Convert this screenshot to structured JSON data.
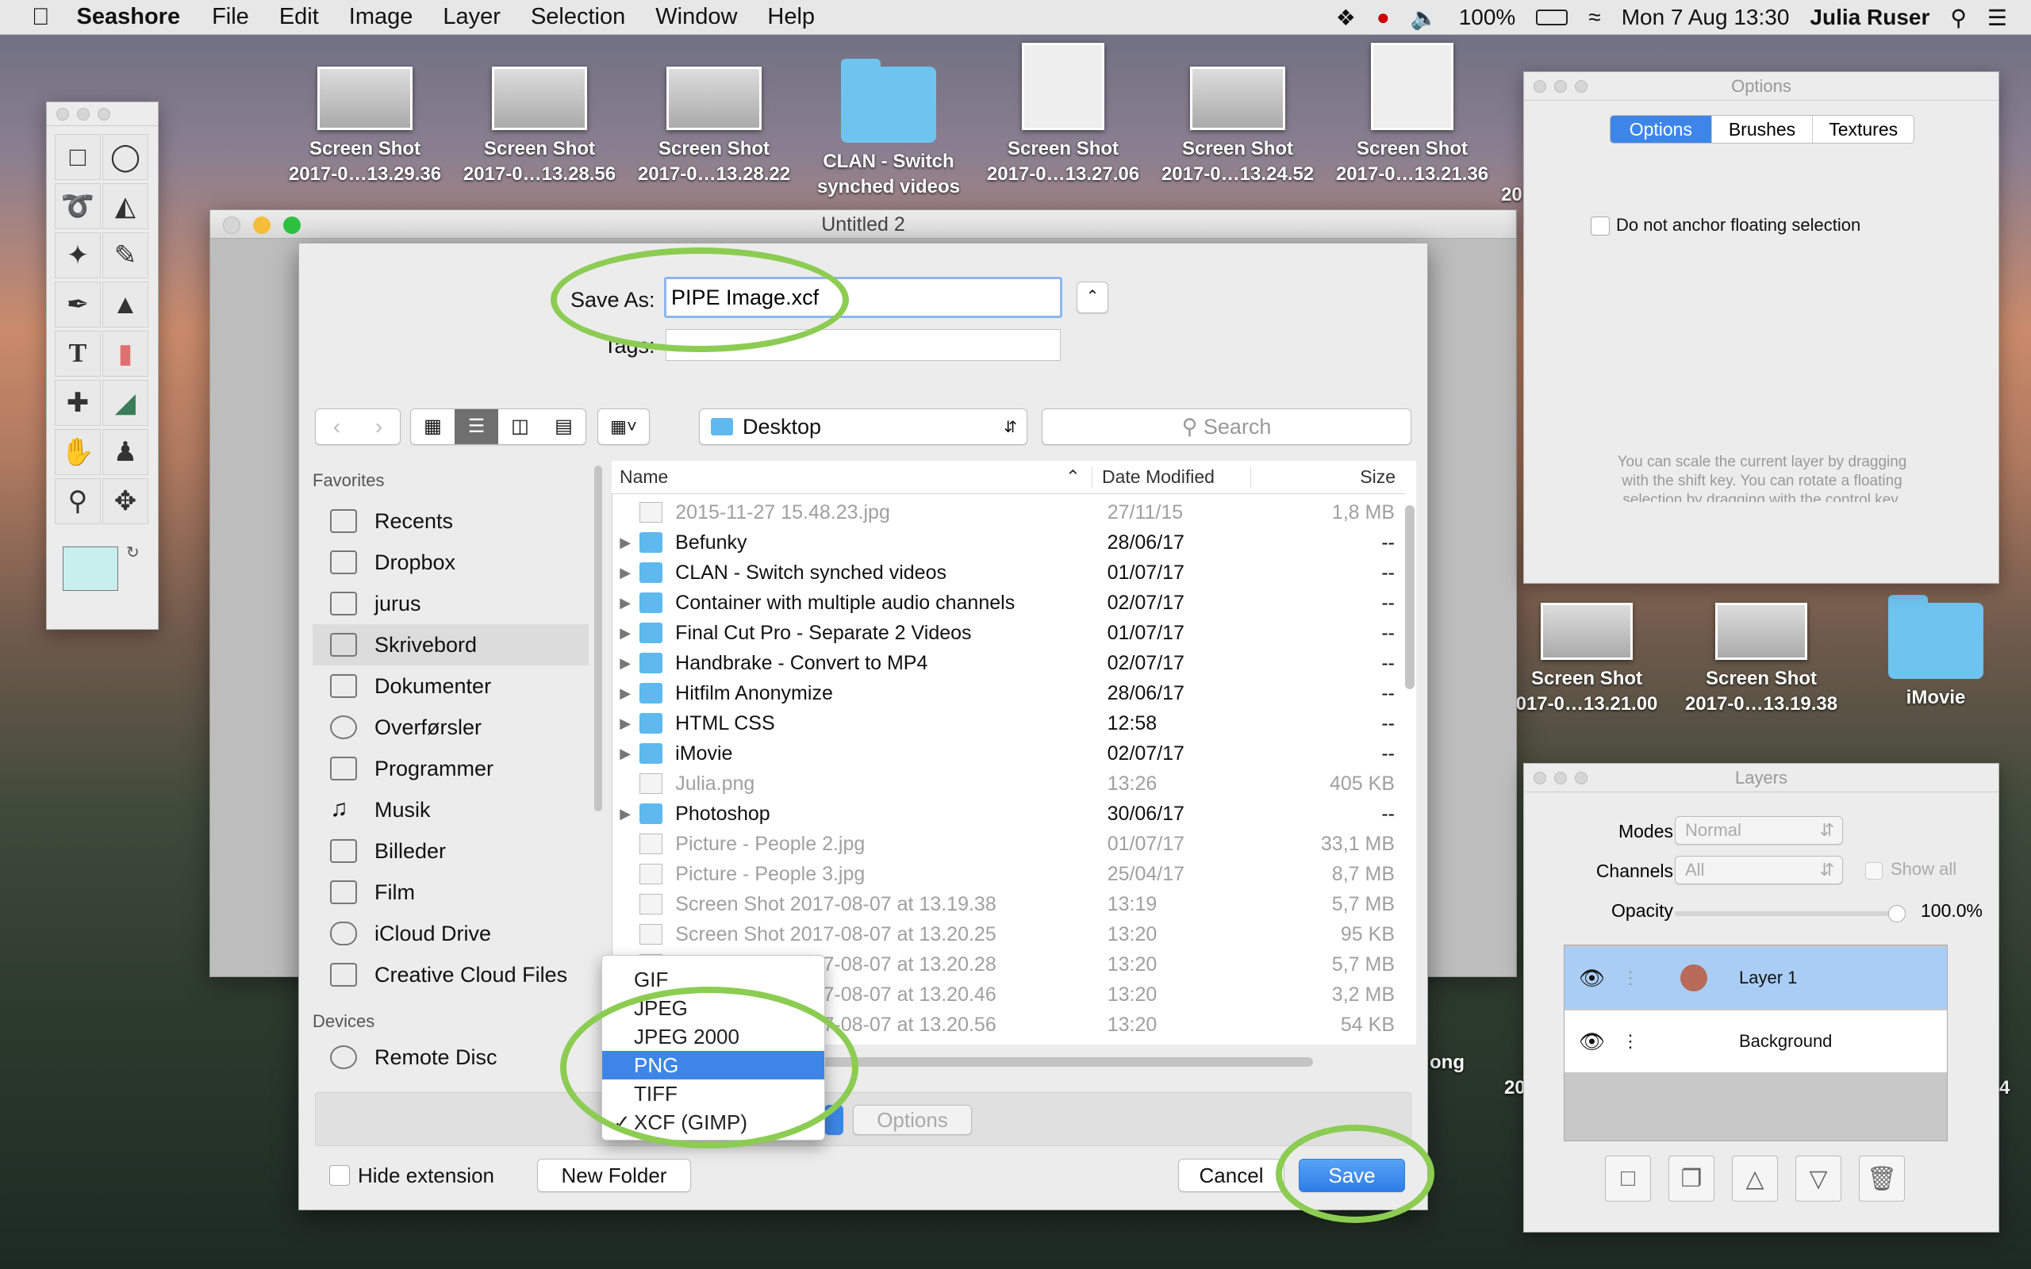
{
  "menubar": {
    "app": "Seashore",
    "items": [
      "File",
      "Edit",
      "Image",
      "Layer",
      "Selection",
      "Window",
      "Help"
    ],
    "battery": "100%",
    "date": "Mon 7 Aug",
    "time": "13:30",
    "user": "Julia Ruser"
  },
  "desktop": {
    "top_icons": [
      {
        "l1": "Screen Shot",
        "l2": "2017-0…13.29.36"
      },
      {
        "l1": "Screen Shot",
        "l2": "2017-0…13.28.56"
      },
      {
        "l1": "Screen Shot",
        "l2": "2017-0…13.28.22"
      },
      {
        "l1": "CLAN - Switch",
        "l2": "synched videos"
      },
      {
        "l1": "Screen Shot",
        "l2": "2017-0…13.27.06"
      },
      {
        "l1": "Screen Shot",
        "l2": "2017-0…13.24.52"
      },
      {
        "l1": "Screen Shot",
        "l2": "2017-0…13.21.36"
      }
    ],
    "right_icons": [
      {
        "l1": "Screen Shot",
        "l2": "017-0…13.21.00"
      },
      {
        "l1": "Screen Shot",
        "l2": "2017-0…13.19.38"
      },
      {
        "l1": "iMovie",
        "l2": ""
      }
    ],
    "partial": {
      "ong": "ong",
      "four": "4",
      "twenty": "20",
      "twenty_top": "20"
    }
  },
  "main_window": {
    "title": "Untitled 2"
  },
  "save_dialog": {
    "save_as_label": "Save As:",
    "filename": "PIPE Image.xcf",
    "tags_label": "Tags:",
    "location": "Desktop",
    "search_placeholder": "Search",
    "sidebar_favorites_title": "Favorites",
    "favorites": [
      "Recents",
      "Dropbox",
      "jurus",
      "Skrivebord",
      "Dokumenter",
      "Overførsler",
      "Programmer",
      "Musik",
      "Billeder",
      "Film",
      "iCloud Drive",
      "Creative Cloud Files"
    ],
    "devices_title": "Devices",
    "devices": [
      "Remote Disc"
    ],
    "columns": {
      "name": "Name",
      "date": "Date Modified",
      "size": "Size"
    },
    "files": [
      {
        "name": "2015-11-27 15.48.23.jpg",
        "date": "27/11/15",
        "size": "1,8 MB",
        "type": "file",
        "dim": true
      },
      {
        "name": "Befunky",
        "date": "28/06/17",
        "size": "--",
        "type": "folder",
        "dim": false
      },
      {
        "name": "CLAN - Switch synched videos",
        "date": "01/07/17",
        "size": "--",
        "type": "folder",
        "dim": false
      },
      {
        "name": "Container with multiple audio channels",
        "date": "02/07/17",
        "size": "--",
        "type": "folder",
        "dim": false
      },
      {
        "name": "Final Cut Pro - Separate 2 Videos",
        "date": "01/07/17",
        "size": "--",
        "type": "folder",
        "dim": false
      },
      {
        "name": "Handbrake - Convert to MP4",
        "date": "02/07/17",
        "size": "--",
        "type": "folder",
        "dim": false
      },
      {
        "name": "Hitfilm Anonymize",
        "date": "28/06/17",
        "size": "--",
        "type": "folder",
        "dim": false
      },
      {
        "name": "HTML CSS",
        "date": "12:58",
        "size": "--",
        "type": "folder",
        "dim": false
      },
      {
        "name": "iMovie",
        "date": "02/07/17",
        "size": "--",
        "type": "folder",
        "dim": false
      },
      {
        "name": "Julia.png",
        "date": "13:26",
        "size": "405 KB",
        "type": "file",
        "dim": true
      },
      {
        "name": "Photoshop",
        "date": "30/06/17",
        "size": "--",
        "type": "folder",
        "dim": false
      },
      {
        "name": "Picture - People 2.jpg",
        "date": "01/07/17",
        "size": "33,1 MB",
        "type": "file",
        "dim": true
      },
      {
        "name": "Picture - People 3.jpg",
        "date": "25/04/17",
        "size": "8,7 MB",
        "type": "file",
        "dim": true
      },
      {
        "name": "Screen Shot 2017-08-07 at 13.19.38",
        "date": "13:19",
        "size": "5,7 MB",
        "type": "file",
        "dim": true
      },
      {
        "name": "Screen Shot 2017-08-07 at 13.20.25",
        "date": "13:20",
        "size": "95 KB",
        "type": "file",
        "dim": true
      },
      {
        "name": "Screen Shot 2017-08-07 at 13.20.28",
        "date": "13:20",
        "size": "5,7 MB",
        "type": "file",
        "dim": true
      },
      {
        "name": "Screen Shot 2017-08-07 at 13.20.46",
        "date": "13:20",
        "size": "3,2 MB",
        "type": "file",
        "dim": true
      },
      {
        "name": "Screen Shot 2017-08-07 at 13.20.56",
        "date": "13:20",
        "size": "54 KB",
        "type": "file",
        "dim": true
      }
    ],
    "formats": [
      "GIF",
      "JPEG",
      "JPEG 2000",
      "PNG",
      "TIFF",
      "XCF (GIMP)"
    ],
    "selected_format": "PNG",
    "checked_format": "XCF (GIMP)",
    "options_label": "Options",
    "hide_extension": "Hide extension",
    "new_folder": "New Folder",
    "cancel": "Cancel",
    "save": "Save"
  },
  "options_panel": {
    "title": "Options",
    "tabs": [
      "Options",
      "Brushes",
      "Textures"
    ],
    "checkbox": "Do not anchor floating selection",
    "help": [
      "You can scale the current layer by dragging",
      "with the shift key. You can rotate a floating",
      "selection by dragging with the control key."
    ]
  },
  "layers_panel": {
    "title": "Layers",
    "modes_label": "Modes",
    "modes_value": "Normal",
    "channels_label": "Channels",
    "channels_value": "All",
    "show_all": "Show all",
    "opacity_label": "Opacity",
    "opacity_value": "100.0%",
    "opacity_level": 1.0,
    "layers": [
      "Layer 1",
      "Background"
    ]
  },
  "colors": {
    "accent": "#3d86e8",
    "highlight_ring": "#8ccc52",
    "folder": "#5fb8ee"
  }
}
